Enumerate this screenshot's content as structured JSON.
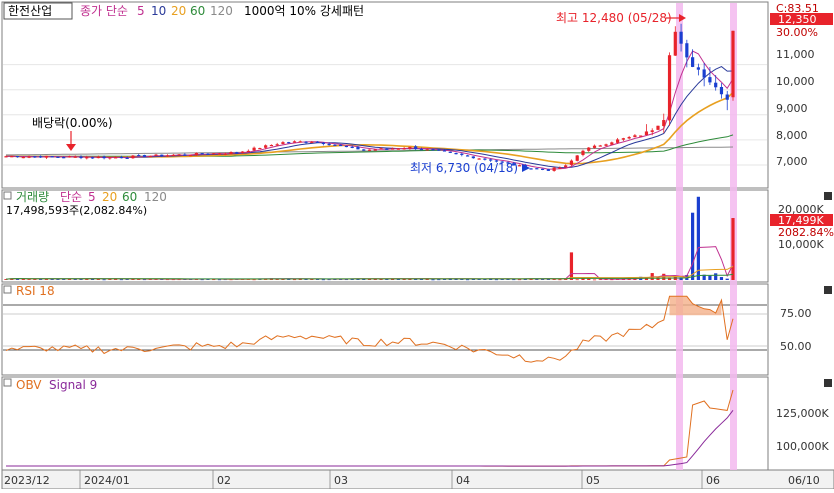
{
  "stock_name": "한전산업",
  "ma_label": "종가 단순",
  "ma_periods": [
    "5",
    "10",
    "20",
    "60",
    "120"
  ],
  "pattern_label": "1000억 10% 강세패턴",
  "colors": {
    "up": "#e8232b",
    "down": "#1a3fd0",
    "ma5": "#c03090",
    "ma10": "#2a3a9a",
    "ma20": "#e8a020",
    "ma60": "#2e8b3a",
    "ma120": "#8a8a8a",
    "rsi": "#e07020",
    "obv": "#e07020",
    "signal": "#8a2a9a",
    "highlight": "#f3b8ef"
  },
  "annotations": {
    "high": "최고 12,480 (05/28)",
    "low": "최저 6,730 (04/18)",
    "dividend": "배당락(0.00%)"
  },
  "price_panel": {
    "current_label": "C:83.51",
    "current_value": "12,350",
    "axis_labels": [
      "30.00%",
      "11,000",
      "10,000",
      "9,000",
      "8,000",
      "7,000"
    ]
  },
  "volume_panel": {
    "title": "거래량",
    "ma_label": "단순",
    "ma_periods": [
      "5",
      "20",
      "60",
      "120"
    ],
    "value_text": "17,498,593주(2,082.84%)",
    "current_value": "17,499K",
    "current_pct": "2082.84%",
    "axis_labels": [
      "20,000K",
      "10,000K"
    ]
  },
  "rsi_panel": {
    "title": "RSI 18",
    "axis_labels": [
      "75.00",
      "50.00"
    ]
  },
  "obv_panel": {
    "title": "OBV",
    "signal_label": "Signal 9",
    "axis_labels": [
      "125,000K",
      "100,000K"
    ]
  },
  "x_axis_labels": [
    "2023/12",
    "2024/01",
    "02",
    "03",
    "04",
    "05",
    "06",
    "06/10"
  ],
  "chart_data": [
    {
      "type": "candlestick",
      "title": "한전산업",
      "y_unit": "KRW",
      "ylim": [
        6600,
        12700
      ],
      "price_anchors": [
        {
          "date": "2023-12",
          "close": 7350
        },
        {
          "date": "2024-01",
          "close": 7300
        },
        {
          "date": "2024-02-20",
          "close": 7900
        },
        {
          "date": "2024-03-05",
          "close": 7600
        },
        {
          "date": "2024-03-20",
          "close": 7550
        },
        {
          "date": "2024-04-18",
          "close": 6730
        },
        {
          "date": "2024-05-02",
          "close": 7600
        },
        {
          "date": "2024-05-20",
          "close": 8300
        },
        {
          "date": "2024-05-28",
          "close": 12480
        },
        {
          "date": "2024-06-05",
          "close": 9600
        },
        {
          "date": "2024-06-10",
          "close": 12350
        }
      ],
      "high": {
        "date": "05/28",
        "value": 12480
      },
      "low": {
        "date": "04/18",
        "value": 6730
      },
      "last_close": 12350
    },
    {
      "type": "bar",
      "title": "거래량",
      "y_unit": "주",
      "last_volume": 17498593,
      "last_volume_pct": 2082.84,
      "spikes": [
        {
          "date": "05/02",
          "value": 7800000
        },
        {
          "date": "05/27",
          "value": 19000000
        },
        {
          "date": "05/28",
          "value": 23500000
        },
        {
          "date": "06/10",
          "value": 17498593
        }
      ],
      "ylim": [
        0,
        24000000
      ]
    },
    {
      "type": "line",
      "title": "RSI 18",
      "ylim": [
        30,
        95
      ],
      "levels": [
        75,
        50
      ],
      "last_value": 72
    },
    {
      "type": "line",
      "title": "OBV",
      "series": [
        {
          "name": "OBV"
        },
        {
          "name": "Signal 9"
        }
      ],
      "ylim": [
        90000000,
        140000000
      ]
    }
  ]
}
